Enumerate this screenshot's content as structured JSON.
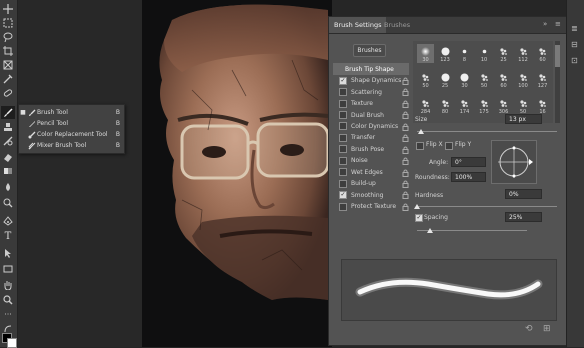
{
  "colors": {
    "panel_bg": "#535353",
    "selected_option": "#6a6a6a",
    "toolbar_bg": "#3a3a3a"
  },
  "flyout": {
    "items": [
      {
        "label": "Brush Tool",
        "key": "B",
        "icon": "brush-icon",
        "active": true
      },
      {
        "label": "Pencil Tool",
        "key": "B",
        "icon": "pencil-icon",
        "active": false
      },
      {
        "label": "Color Replacement Tool",
        "key": "B",
        "icon": "color-replacement-icon",
        "active": false
      },
      {
        "label": "Mixer Brush Tool",
        "key": "B",
        "icon": "mixer-brush-icon",
        "active": false
      }
    ]
  },
  "panel": {
    "tabs": [
      {
        "label": "Brush Settings",
        "active": true
      },
      {
        "label": "Brushes",
        "active": false
      }
    ],
    "menu_icon": "»",
    "brushes_button": "Brushes",
    "options": [
      {
        "label": "Brush Tip Shape",
        "checkbox": false,
        "checked": false,
        "lock": false,
        "selected": true
      },
      {
        "label": "Shape Dynamics",
        "checkbox": true,
        "checked": true,
        "lock": true
      },
      {
        "label": "Scattering",
        "checkbox": true,
        "checked": false,
        "lock": true
      },
      {
        "label": "Texture",
        "checkbox": true,
        "checked": false,
        "lock": true
      },
      {
        "label": "Dual Brush",
        "checkbox": true,
        "checked": false,
        "lock": true
      },
      {
        "label": "Color Dynamics",
        "checkbox": true,
        "checked": false,
        "lock": true
      },
      {
        "label": "Transfer",
        "checkbox": true,
        "checked": false,
        "lock": true
      },
      {
        "label": "Brush Pose",
        "checkbox": true,
        "checked": false,
        "lock": true
      },
      {
        "label": "Noise",
        "checkbox": true,
        "checked": false,
        "lock": true
      },
      {
        "label": "Wet Edges",
        "checkbox": true,
        "checked": false,
        "lock": true
      },
      {
        "label": "Build-up",
        "checkbox": true,
        "checked": false,
        "lock": true
      },
      {
        "label": "Smoothing",
        "checkbox": true,
        "checked": true,
        "lock": true
      },
      {
        "label": "Protect Texture",
        "checkbox": true,
        "checked": false,
        "lock": true
      }
    ],
    "presets": [
      {
        "size": "30",
        "tip": "soft",
        "selected": true
      },
      {
        "size": "123",
        "tip": "hard"
      },
      {
        "size": "8",
        "tip": "small"
      },
      {
        "size": "10",
        "tip": "small"
      },
      {
        "size": "25",
        "tip": "splat"
      },
      {
        "size": "112",
        "tip": "splat"
      },
      {
        "size": "60",
        "tip": "splat"
      },
      {
        "size": "50",
        "tip": "splat"
      },
      {
        "size": "25",
        "tip": "hard"
      },
      {
        "size": "30",
        "tip": "hard"
      },
      {
        "size": "50",
        "tip": "splat"
      },
      {
        "size": "60",
        "tip": "splat"
      },
      {
        "size": "100",
        "tip": "splat"
      },
      {
        "size": "127",
        "tip": "splat"
      },
      {
        "size": "284",
        "tip": "splat"
      },
      {
        "size": "80",
        "tip": "splat"
      },
      {
        "size": "174",
        "tip": "splat"
      },
      {
        "size": "175",
        "tip": "splat"
      },
      {
        "size": "306",
        "tip": "splat"
      },
      {
        "size": "50",
        "tip": "splat"
      },
      {
        "size": "16",
        "tip": "splat"
      }
    ],
    "size": {
      "label": "Size",
      "value": "13 px",
      "level": 0.03
    },
    "flip_x": {
      "label": "Flip X",
      "checked": false
    },
    "flip_y": {
      "label": "Flip Y",
      "checked": false
    },
    "angle": {
      "label": "Angle:",
      "value": "0°"
    },
    "roundness": {
      "label": "Roundness:",
      "value": "100%"
    },
    "hardness": {
      "label": "Hardness",
      "value": "0%",
      "level": 0.0
    },
    "spacing": {
      "label": "Spacing",
      "value": "25%",
      "checked": true,
      "level": 0.12
    }
  }
}
